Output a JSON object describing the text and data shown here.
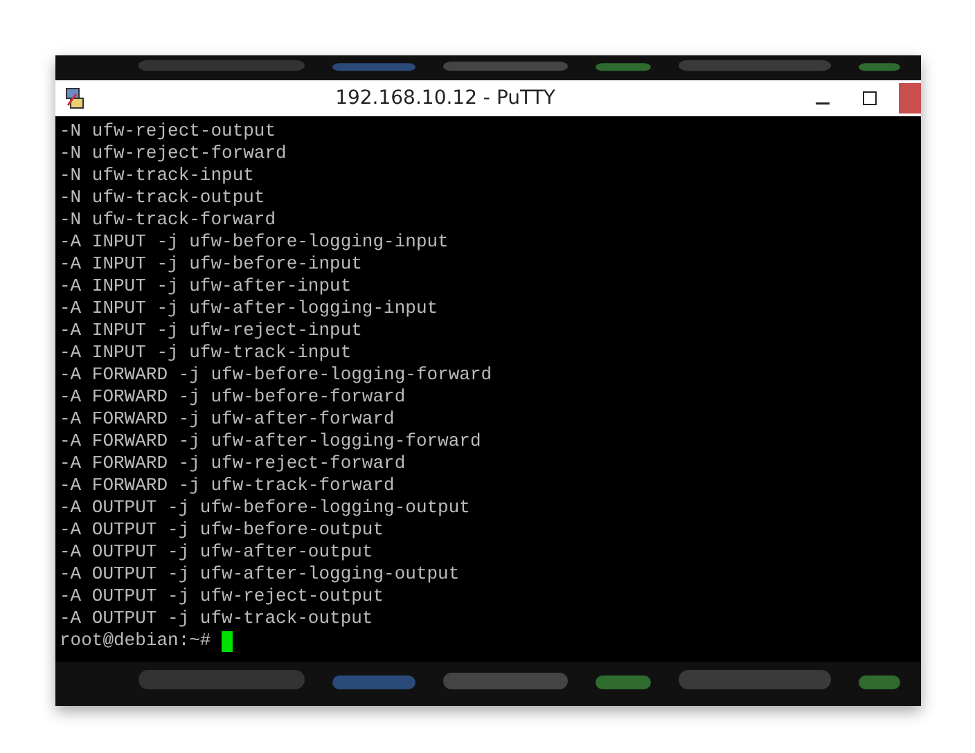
{
  "window": {
    "title": "192.168.10.12 - PuTTY"
  },
  "terminal": {
    "lines": [
      "-N ufw-reject-output",
      "-N ufw-reject-forward",
      "-N ufw-track-input",
      "-N ufw-track-output",
      "-N ufw-track-forward",
      "-A INPUT -j ufw-before-logging-input",
      "-A INPUT -j ufw-before-input",
      "-A INPUT -j ufw-after-input",
      "-A INPUT -j ufw-after-logging-input",
      "-A INPUT -j ufw-reject-input",
      "-A INPUT -j ufw-track-input",
      "-A FORWARD -j ufw-before-logging-forward",
      "-A FORWARD -j ufw-before-forward",
      "-A FORWARD -j ufw-after-forward",
      "-A FORWARD -j ufw-after-logging-forward",
      "-A FORWARD -j ufw-reject-forward",
      "-A FORWARD -j ufw-track-forward",
      "-A OUTPUT -j ufw-before-logging-output",
      "-A OUTPUT -j ufw-before-output",
      "-A OUTPUT -j ufw-after-output",
      "-A OUTPUT -j ufw-after-logging-output",
      "-A OUTPUT -j ufw-reject-output",
      "-A OUTPUT -j ufw-track-output"
    ],
    "prompt": "root@debian:~#"
  }
}
